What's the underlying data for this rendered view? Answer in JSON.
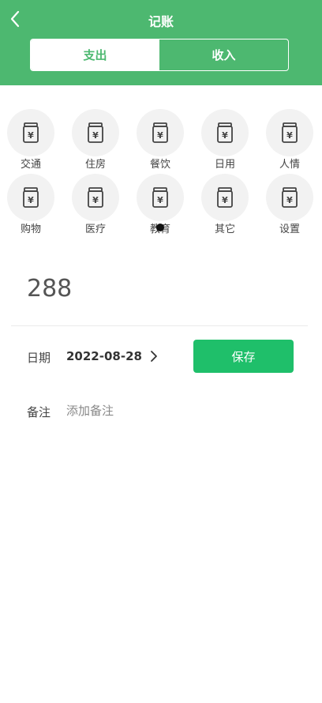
{
  "header": {
    "title": "记账",
    "back_icon": "chevron-left-icon",
    "tabs": [
      {
        "label": "支出",
        "active": true
      },
      {
        "label": "收入",
        "active": false
      }
    ]
  },
  "categories": {
    "icon": "yuan-jar-icon",
    "rows": [
      [
        "交通",
        "住房",
        "餐饮",
        "日用",
        "人情"
      ],
      [
        "购物",
        "医疗",
        "教育",
        "其它",
        "设置"
      ]
    ]
  },
  "amount": "288",
  "date": {
    "label": "日期",
    "value": "2022-08-28",
    "chevron_icon": "chevron-right-icon"
  },
  "save_label": "保存",
  "note": {
    "label": "备注",
    "placeholder": "添加备注"
  },
  "colors": {
    "primary": "#4db870",
    "save_button": "#1fbf6a",
    "icon_bg": "#f2f2f2"
  }
}
